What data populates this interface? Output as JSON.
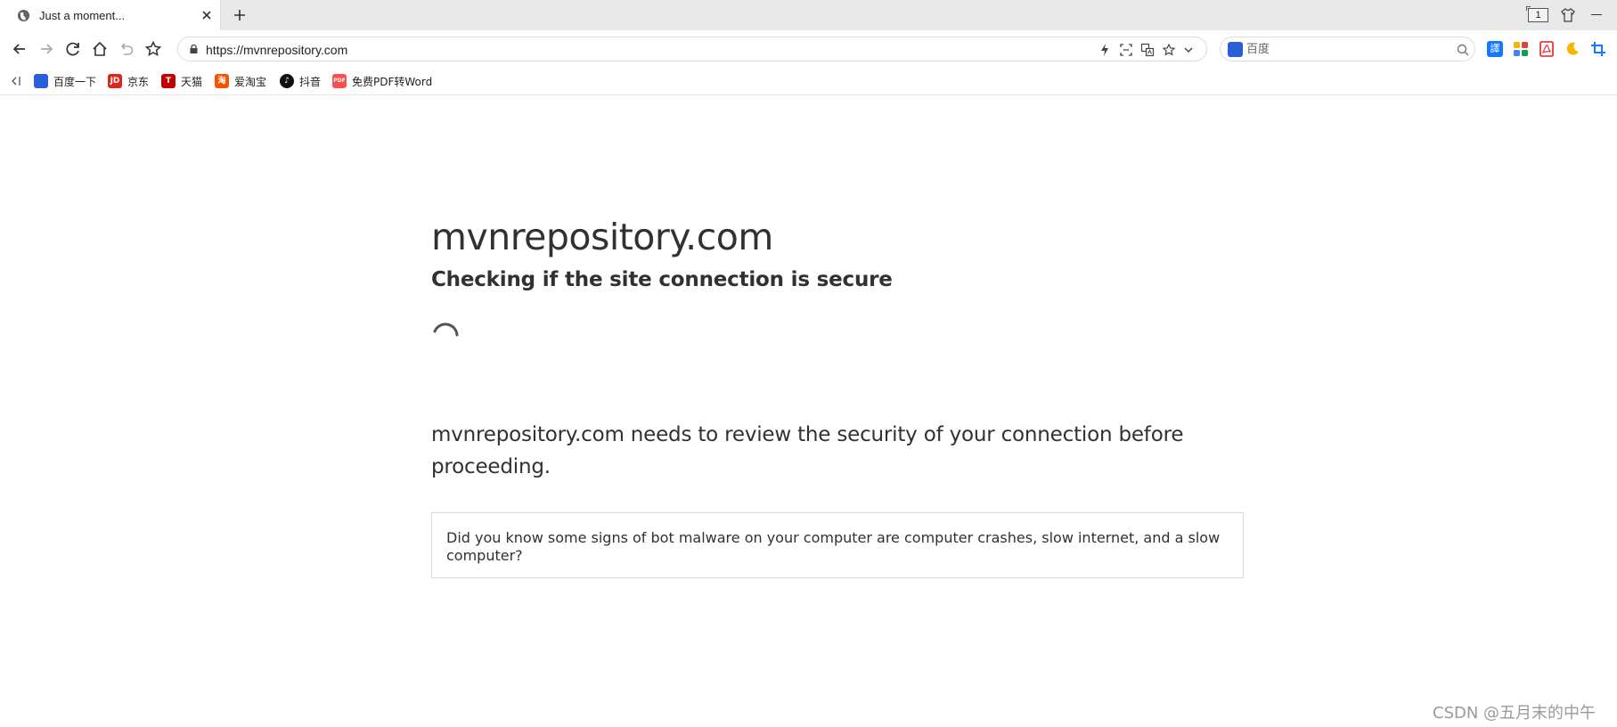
{
  "tab": {
    "title": "Just a moment...",
    "favicon": "globe-icon"
  },
  "window": {
    "tab_count": "1"
  },
  "address_bar": {
    "url": "https://mvnrepository.com"
  },
  "search_box": {
    "engine_icon": "baidu-paw-icon",
    "placeholder": "百度"
  },
  "bookmarks": [
    {
      "label": "百度一下",
      "icon": "baidu-paw-icon",
      "color": "#2b5ddc"
    },
    {
      "label": "京东",
      "icon": "jd-icon",
      "color": "#e1251b"
    },
    {
      "label": "天猫",
      "icon": "tmall-icon",
      "color": "#c40000"
    },
    {
      "label": "爱淘宝",
      "icon": "taobao-icon",
      "color": "#ff5000"
    },
    {
      "label": "抖音",
      "icon": "douyin-icon",
      "color": "#111111"
    },
    {
      "label": "免费PDF转Word",
      "icon": "pdf-icon",
      "color": "#ff4d4f"
    }
  ],
  "page": {
    "site_title": "mvnrepository.com",
    "subtitle": "Checking if the site connection is secure",
    "review_text": "mvnrepository.com needs to review the security of your connection before proceeding.",
    "tip_text": "Did you know some signs of bot malware on your computer are computer crashes, slow internet, and a slow computer?"
  },
  "watermark": "CSDN @五月末的中午",
  "colors": {
    "text": "#313131",
    "tab_strip": "#e8e8e8",
    "border": "#d9d9d9"
  }
}
